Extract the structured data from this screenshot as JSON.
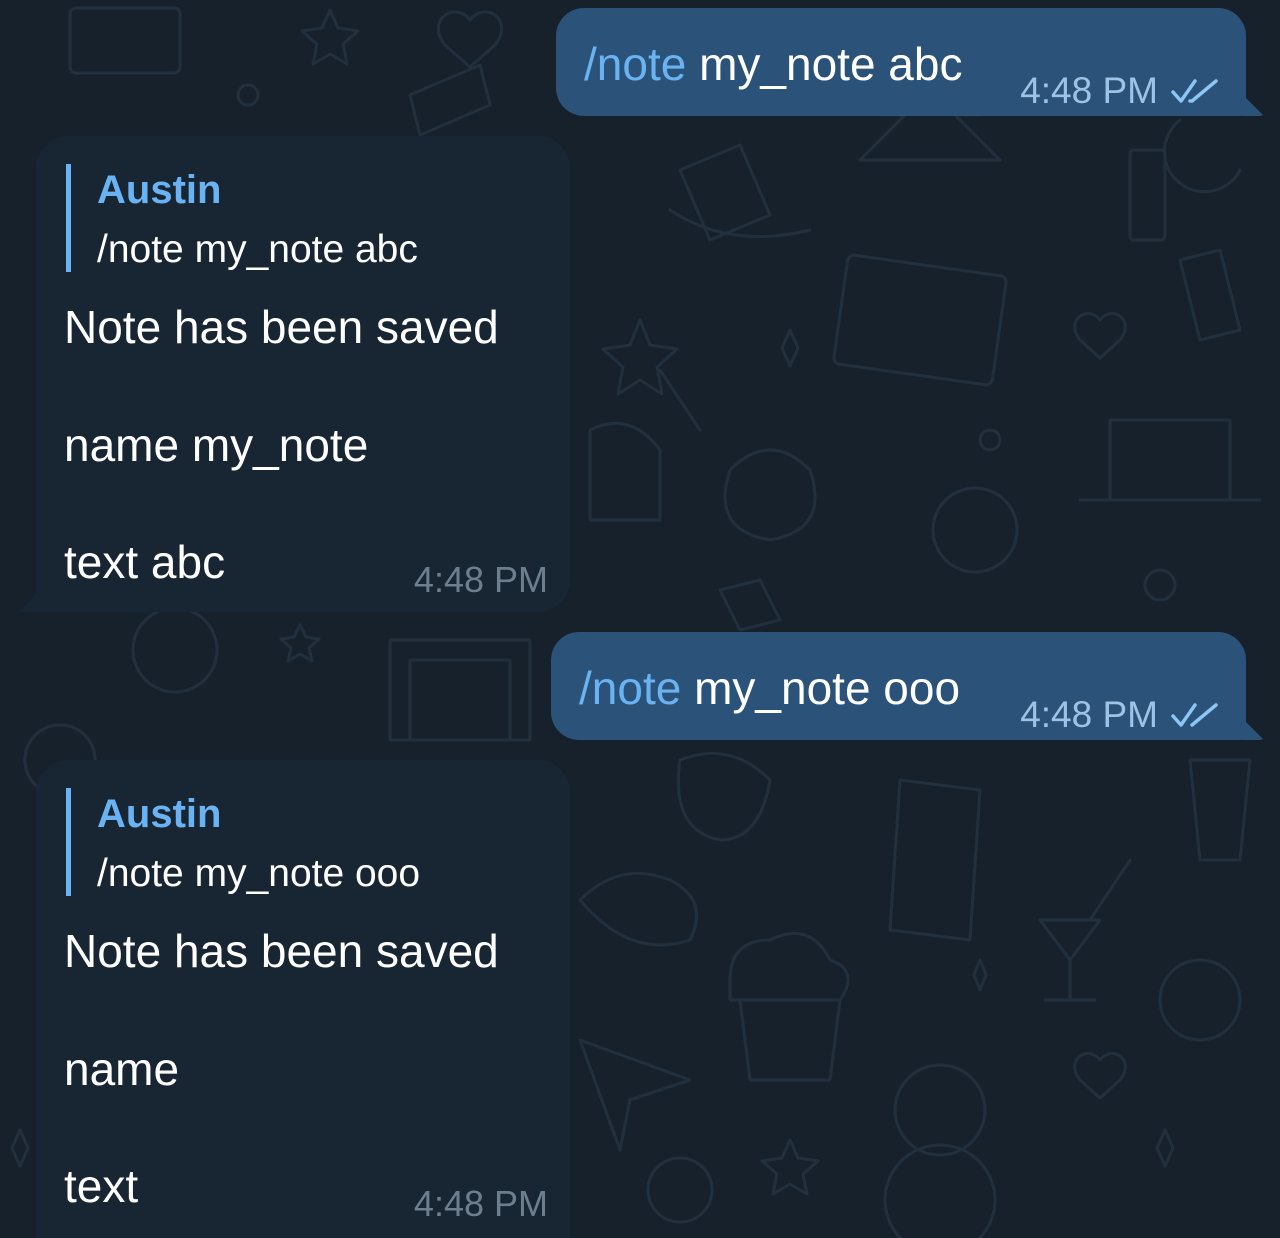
{
  "messages": [
    {
      "direction": "outgoing",
      "command": "/note",
      "text": " my_note abc",
      "time": "4:48 PM",
      "status": "read"
    },
    {
      "direction": "incoming",
      "reply_to": {
        "author": "Austin",
        "text": "/note my_note abc"
      },
      "lines": [
        "Note has been saved",
        "name my_note",
        "text abc"
      ],
      "time": "4:48 PM"
    },
    {
      "direction": "outgoing",
      "command": "/note",
      "text": " my_note ooo",
      "time": "4:48 PM",
      "status": "read"
    },
    {
      "direction": "incoming",
      "reply_to": {
        "author": "Austin",
        "text": "/note my_note ooo"
      },
      "lines": [
        "Note has been saved",
        "name",
        "text"
      ],
      "time": "4:48 PM"
    }
  ],
  "colors": {
    "background": "#17212b",
    "outgoing_bubble": "#2b5278",
    "incoming_bubble": "#182533",
    "accent": "#6ab3f3"
  },
  "icons": {
    "read_status": "double-check-icon"
  }
}
